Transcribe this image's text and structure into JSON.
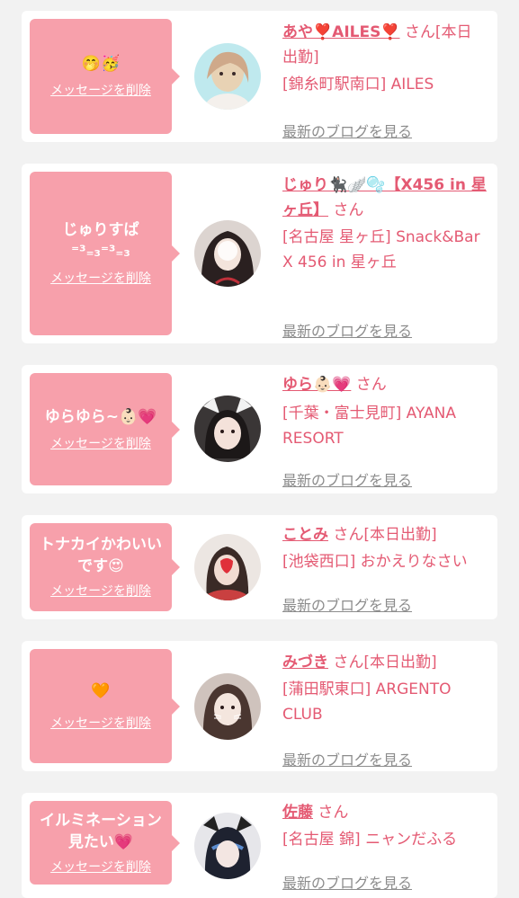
{
  "delete_label": "メッセージを削除",
  "blog_label": "最新のブログを見る",
  "san_label": "さん",
  "colors": {
    "accent": "#e45a73",
    "bubble": "#f7a0ab",
    "blog_link": "#8c8c8c"
  },
  "entries": [
    {
      "message": "🤭🥳",
      "name": "あや❣️AILES❣️",
      "status": "[本日出勤]",
      "shop": "[錦糸町駅南口] AILES"
    },
    {
      "message": "じゅりすぱ ⁼³₌₃⁼³₌₃",
      "name": "じゅり🐈‍⬛🪽🫧【X456 in 星ヶ丘】",
      "status": "",
      "shop": "[名古屋 星ヶ丘] Snack&Bar X 456 in 星ヶ丘"
    },
    {
      "message": "ゆらゆら~👶🏻💗",
      "name": "ゆら👶🏻💗",
      "status": "",
      "shop": "[千葉・富士見町] AYANA RESORT"
    },
    {
      "message": "トナカイかわいいです😍",
      "name": "ことみ",
      "status": "[本日出勤]",
      "shop": "[池袋西口] おかえりなさい"
    },
    {
      "message": "🧡",
      "name": "みづき",
      "status": "[本日出勤]",
      "shop": "[蒲田駅東口] ARGENTO CLUB"
    },
    {
      "message": "イルミネーション見たい💗",
      "name": "佐藤",
      "status": "",
      "shop": "[名古屋 錦] ニャンだふる"
    }
  ]
}
